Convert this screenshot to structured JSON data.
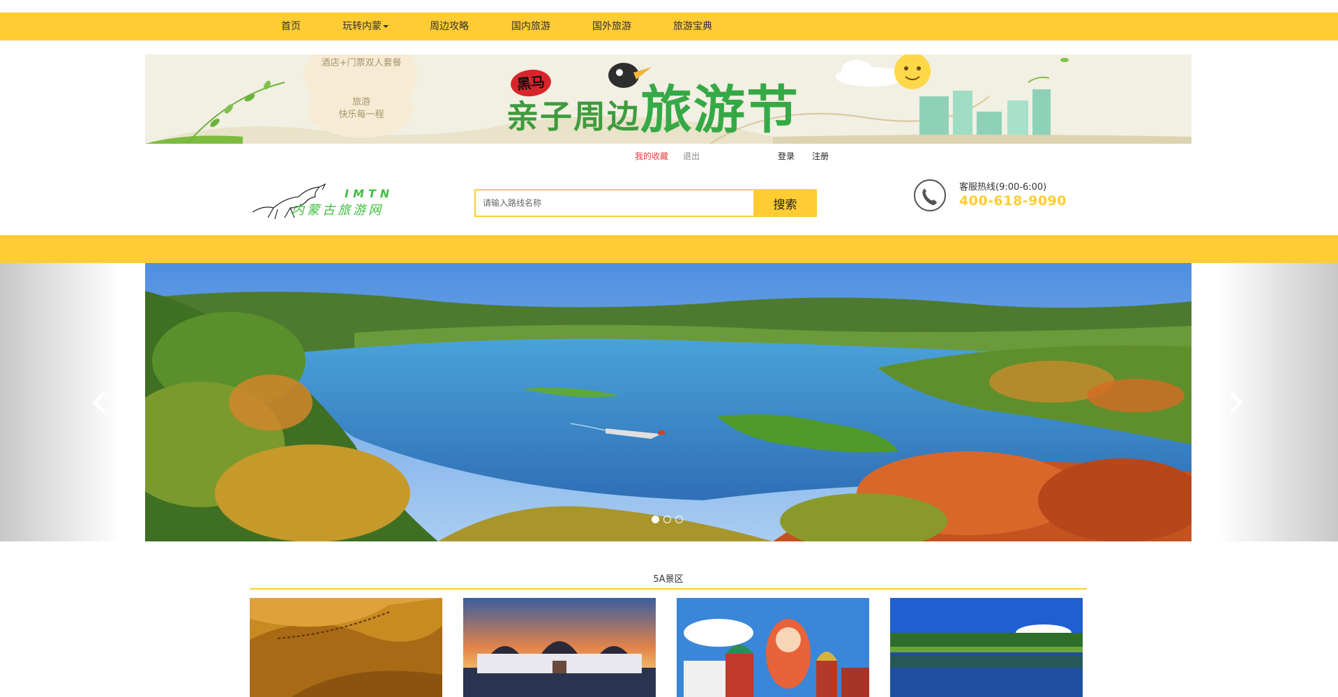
{
  "nav": {
    "items": [
      {
        "label": "首页"
      },
      {
        "label": "玩转内蒙"
      },
      {
        "label": "周边攻略"
      },
      {
        "label": "国内旅游"
      },
      {
        "label": "国外旅游"
      },
      {
        "label": "旅游宝典"
      }
    ]
  },
  "banner": {
    "promo_line1": "酒店+门票双人套餐",
    "promo_line2": "旅游",
    "promo_line3": "快乐每一程",
    "brand": "黑马",
    "title_small": "亲子周边",
    "title_big": "旅游节"
  },
  "user_links": {
    "favorites": "我的收藏",
    "logout": "退出",
    "login": "登录",
    "register": "注册"
  },
  "logo": {
    "en": "IMTN",
    "cn": "内蒙古旅游网"
  },
  "search": {
    "placeholder": "请输入路线名称",
    "button": "搜索"
  },
  "hotline": {
    "label": "客服热线(9:00-6:00)",
    "number": "400-618-9090"
  },
  "carousel": {
    "slide_count": 3,
    "active_index": 0
  },
  "section": {
    "title": "5A景区"
  },
  "colors": {
    "accent": "#ffcc33",
    "favorites_link": "#e03b3b",
    "logo_green": "#3fbf3f"
  }
}
